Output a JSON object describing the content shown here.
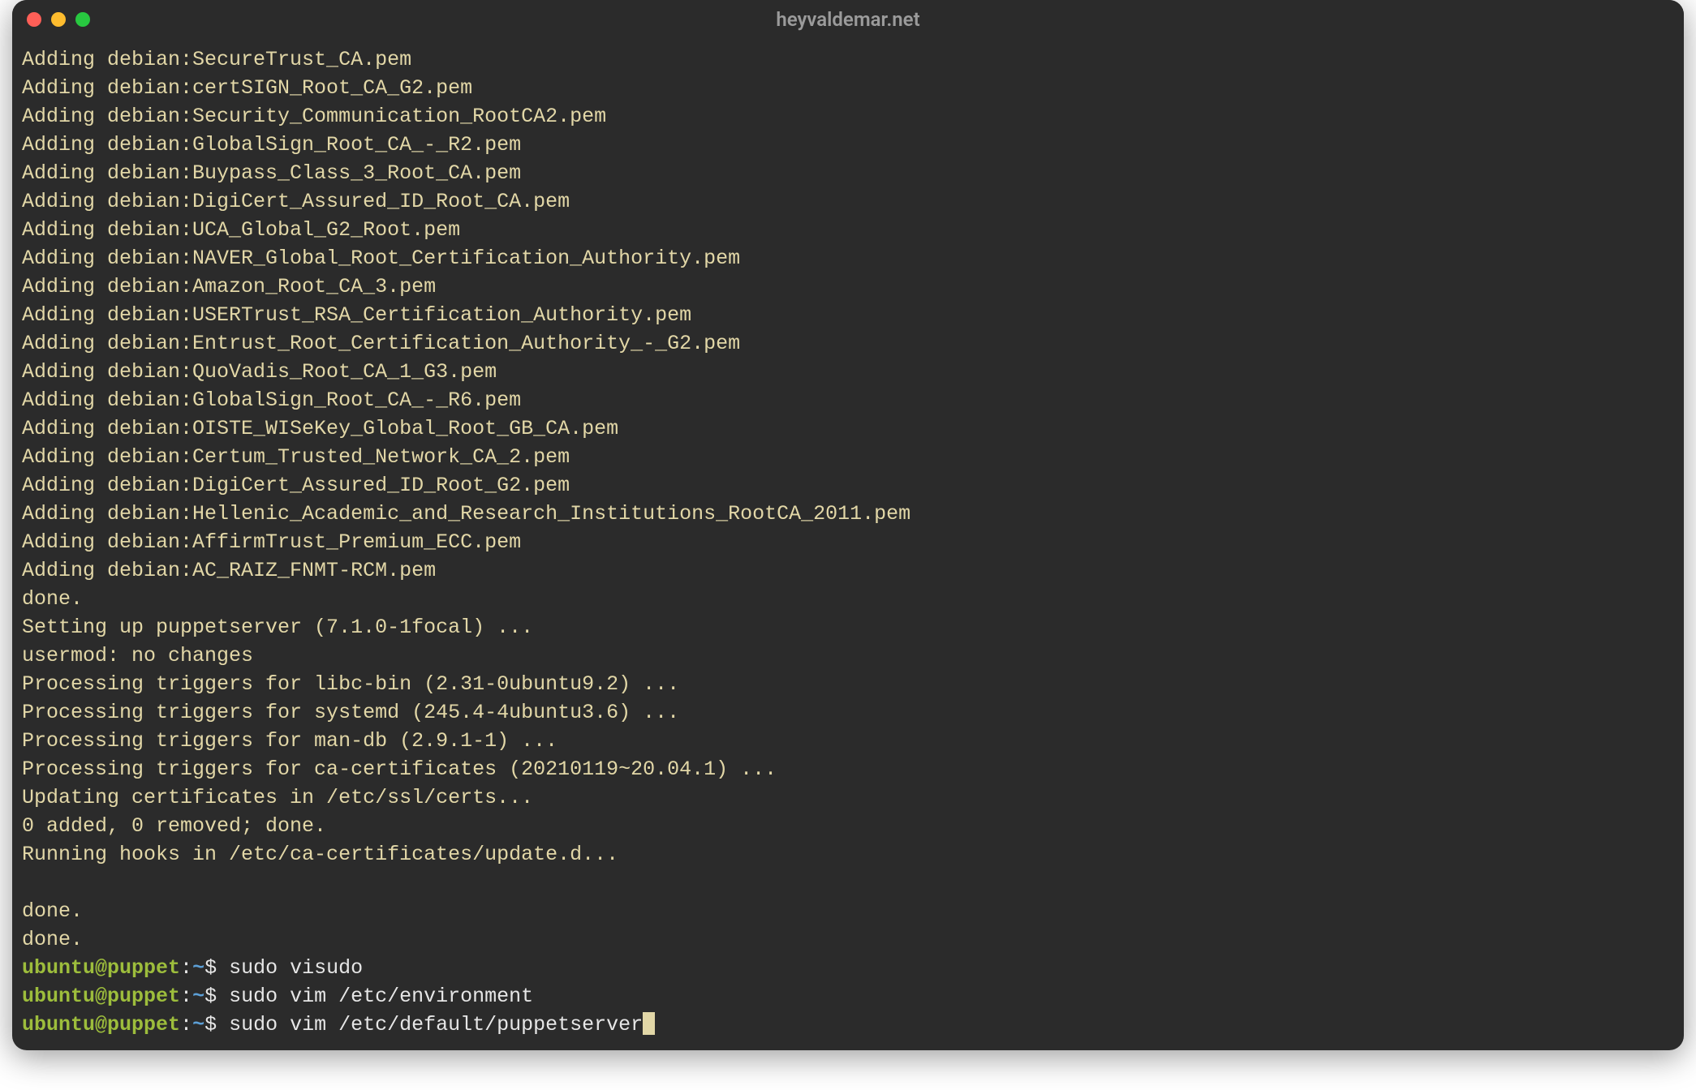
{
  "window": {
    "title": "heyvaldemar.net"
  },
  "output_lines": [
    "Adding debian:SecureTrust_CA.pem",
    "Adding debian:certSIGN_Root_CA_G2.pem",
    "Adding debian:Security_Communication_RootCA2.pem",
    "Adding debian:GlobalSign_Root_CA_-_R2.pem",
    "Adding debian:Buypass_Class_3_Root_CA.pem",
    "Adding debian:DigiCert_Assured_ID_Root_CA.pem",
    "Adding debian:UCA_Global_G2_Root.pem",
    "Adding debian:NAVER_Global_Root_Certification_Authority.pem",
    "Adding debian:Amazon_Root_CA_3.pem",
    "Adding debian:USERTrust_RSA_Certification_Authority.pem",
    "Adding debian:Entrust_Root_Certification_Authority_-_G2.pem",
    "Adding debian:QuoVadis_Root_CA_1_G3.pem",
    "Adding debian:GlobalSign_Root_CA_-_R6.pem",
    "Adding debian:OISTE_WISeKey_Global_Root_GB_CA.pem",
    "Adding debian:Certum_Trusted_Network_CA_2.pem",
    "Adding debian:DigiCert_Assured_ID_Root_G2.pem",
    "Adding debian:Hellenic_Academic_and_Research_Institutions_RootCA_2011.pem",
    "Adding debian:AffirmTrust_Premium_ECC.pem",
    "Adding debian:AC_RAIZ_FNMT-RCM.pem",
    "done.",
    "Setting up puppetserver (7.1.0-1focal) ...",
    "usermod: no changes",
    "Processing triggers for libc-bin (2.31-0ubuntu9.2) ...",
    "Processing triggers for systemd (245.4-4ubuntu3.6) ...",
    "Processing triggers for man-db (2.9.1-1) ...",
    "Processing triggers for ca-certificates (20210119~20.04.1) ...",
    "Updating certificates in /etc/ssl/certs...",
    "0 added, 0 removed; done.",
    "Running hooks in /etc/ca-certificates/update.d...",
    "",
    "done.",
    "done."
  ],
  "prompt": {
    "user_host": "ubuntu@puppet",
    "colon": ":",
    "path": "~",
    "dollar": "$"
  },
  "commands": [
    {
      "text": "sudo visudo",
      "cursor": false
    },
    {
      "text": "sudo vim /etc/environment",
      "cursor": false
    },
    {
      "text": "sudo vim /etc/default/puppetserver",
      "cursor": true
    }
  ]
}
